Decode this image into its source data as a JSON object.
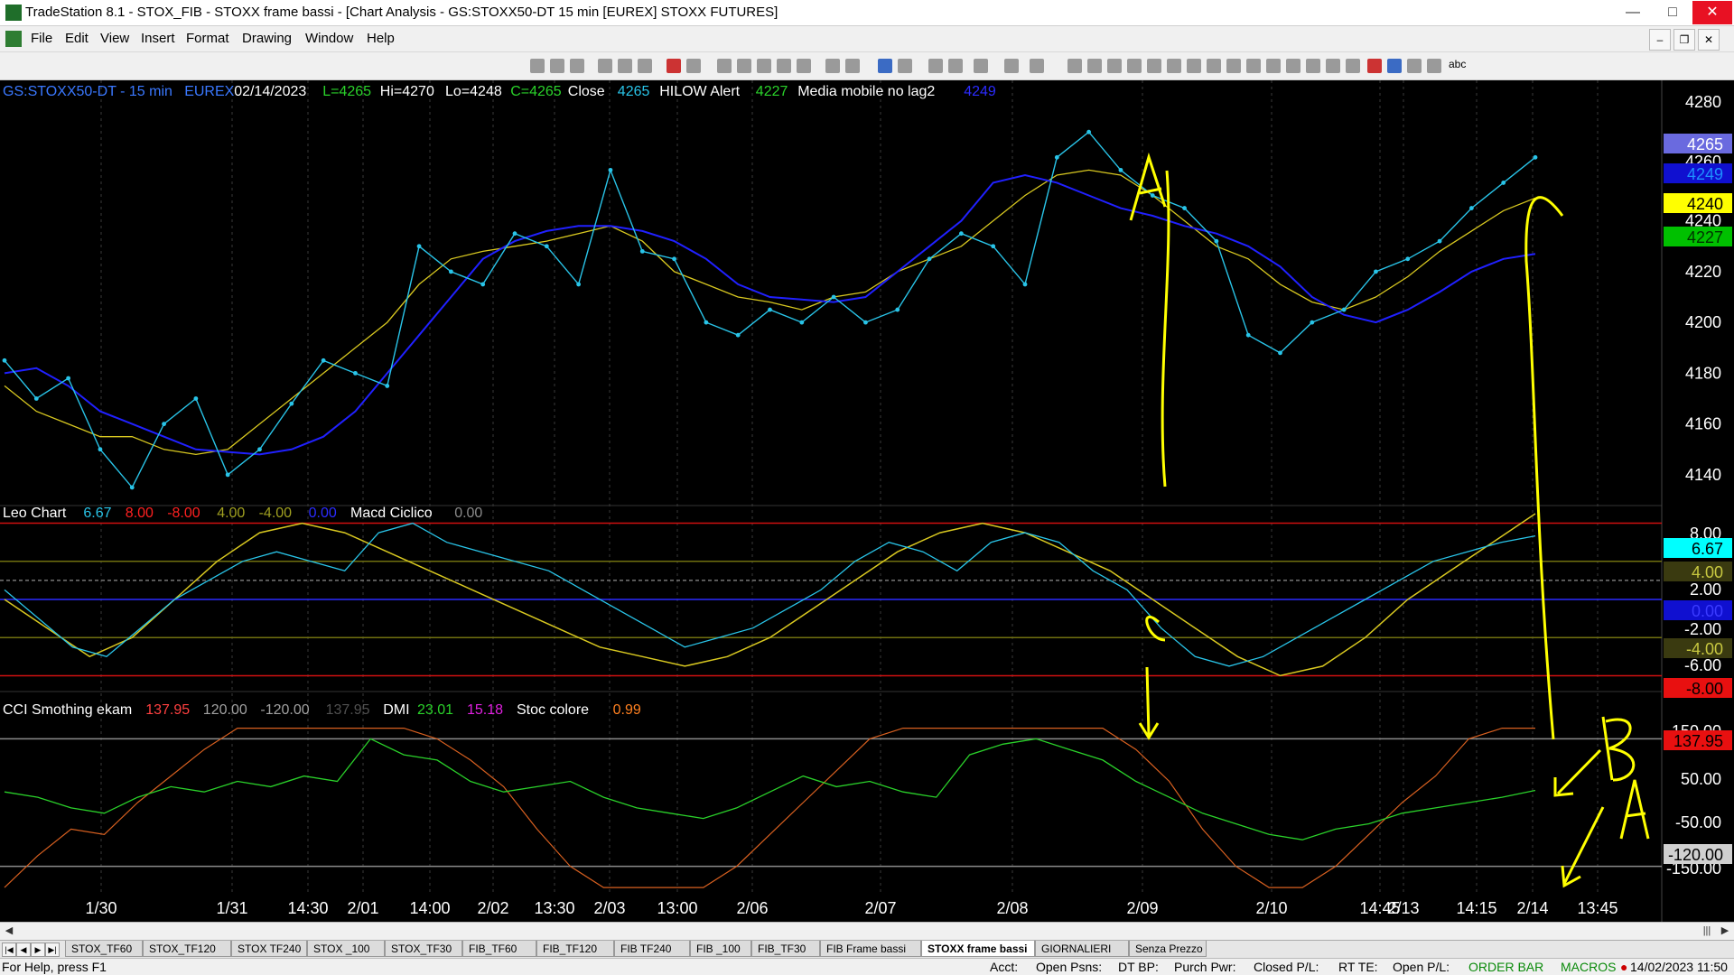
{
  "window": {
    "title": "TradeStation 8.1 - STOX_FIB - STOXX frame bassi - [Chart Analysis - GS:STOXX50-DT  15 min  [EUREX] STOXX FUTURES]"
  },
  "menu": [
    "File",
    "Edit",
    "View",
    "Insert",
    "Format",
    "Drawing",
    "Window",
    "Help"
  ],
  "toolbar": {
    "text_label": "abc"
  },
  "price_panel": {
    "header": [
      {
        "text": "GS:STOXX50-DT - 15 min",
        "color": "#3a78ff"
      },
      {
        "text": "EUREX",
        "color": "#3a78ff"
      },
      {
        "text": "02/14/2023",
        "color": "#ffffff"
      },
      {
        "text": "L=4265",
        "color": "#2ad12a"
      },
      {
        "text": "Hi=4270",
        "color": "#ffffff"
      },
      {
        "text": "Lo=4248",
        "color": "#ffffff"
      },
      {
        "text": "C=4265",
        "color": "#2ad12a"
      },
      {
        "text": "Close",
        "color": "#ffffff"
      },
      {
        "text": "4265",
        "color": "#29c4e8"
      },
      {
        "text": "HILOW Alert",
        "color": "#ffffff"
      },
      {
        "text": "4227",
        "color": "#2ad12a"
      },
      {
        "text": "Media mobile no lag2",
        "color": "#ffffff"
      },
      {
        "text": "4249",
        "color": "#2b2bff"
      }
    ],
    "axis_ticks": [
      "4240",
      "4220",
      "4200",
      "4180",
      "4160",
      "4140"
    ],
    "axis_partial": [
      "4280",
      "4260"
    ],
    "price_tags": [
      {
        "text": "4265",
        "bg": "#6a6adf",
        "fg": "#ffffff"
      },
      {
        "text": "4249",
        "bg": "#1010d0",
        "fg": "#1e90ff"
      },
      {
        "text": "4240",
        "bg": "#ffff00",
        "fg": "#000000"
      },
      {
        "text": "4227",
        "bg": "#00c000",
        "fg": "#003300"
      }
    ]
  },
  "macd_panel": {
    "header": [
      {
        "text": "Leo Chart",
        "color": "#ffffff"
      },
      {
        "text": "6.67",
        "color": "#29c4e8"
      },
      {
        "text": "8.00",
        "color": "#ff2020"
      },
      {
        "text": "-8.00",
        "color": "#ff2020"
      },
      {
        "text": "4.00",
        "color": "#a0a020"
      },
      {
        "text": "-4.00",
        "color": "#a0a020"
      },
      {
        "text": "0.00",
        "color": "#2b2bff"
      },
      {
        "text": "Macd Ciclico",
        "color": "#ffffff"
      },
      {
        "text": "0.00",
        "color": "#8a8a8a"
      }
    ],
    "axis_ticks": [
      "2.00",
      "-2.00",
      "-6.00"
    ],
    "axis_partial": [
      "8.00"
    ],
    "tags": [
      {
        "text": "6.67",
        "bg": "#00ffff",
        "fg": "#000000"
      },
      {
        "text": "4.00",
        "bg": "#3a3a10",
        "fg": "#c8c840"
      },
      {
        "text": "0.00",
        "bg": "#1010d0",
        "fg": "#3a3aff"
      },
      {
        "text": "-4.00",
        "bg": "#3a3a10",
        "fg": "#c8c840"
      },
      {
        "text": "-8.00",
        "bg": "#e81010",
        "fg": "#000000"
      }
    ]
  },
  "cci_panel": {
    "header": [
      {
        "text": "CCI Smothing ekam",
        "color": "#ffffff"
      },
      {
        "text": "137.95",
        "color": "#ff4040"
      },
      {
        "text": "120.00",
        "color": "#a0a0a0"
      },
      {
        "text": "-120.00",
        "color": "#a0a0a0"
      },
      {
        "text": "137.95",
        "color": "#505050"
      },
      {
        "text": "DMI",
        "color": "#ffffff"
      },
      {
        "text": "23.01",
        "color": "#2ad12a"
      },
      {
        "text": "15.18",
        "color": "#e020e0"
      },
      {
        "text": "Stoc colore",
        "color": "#ffffff"
      },
      {
        "text": "0.99",
        "color": "#ff8020"
      }
    ],
    "axis_ticks": [
      "50.00",
      "-50.00"
    ],
    "axis_partial": [
      "150.00",
      "-150.00"
    ],
    "tags": [
      {
        "text": "137.95",
        "bg": "#e81010",
        "fg": "#000000"
      },
      {
        "text": "120.00",
        "bg": "#d0d0d0",
        "fg": "#000000"
      },
      {
        "text": "-120.00",
        "bg": "#d0d0d0",
        "fg": "#000000"
      }
    ]
  },
  "time_axis": [
    "1/30",
    "1/31",
    "14:30",
    "2/01",
    "14:00",
    "2/02",
    "13:30",
    "2/03",
    "13:00",
    "2/06",
    "2/07",
    "2/08",
    "2/09",
    "2/10",
    "14:45",
    "2/13",
    "14:15",
    "2/14",
    "13:45"
  ],
  "annotations": [
    "A",
    "C",
    "B",
    "A"
  ],
  "chart_data": [
    {
      "type": "line",
      "title": "",
      "series": [
        {
          "name": "Close",
          "values": [
            4185,
            4170,
            4178,
            4150,
            4135,
            4160,
            4170,
            4140,
            4150,
            4168,
            4185,
            4180,
            4175,
            4230,
            4220,
            4215,
            4235,
            4230,
            4215,
            4260,
            4228,
            4225,
            4200,
            4195,
            4205,
            4200,
            4210,
            4200,
            4205,
            4225,
            4235,
            4230,
            4215,
            4265,
            4275,
            4260,
            4250,
            4245,
            4232,
            4195,
            4188,
            4200,
            4205,
            4220,
            4225,
            4232,
            4245,
            4255,
            4265
          ]
        },
        {
          "name": "HILOW Alert",
          "values": [
            4180,
            4182,
            4175,
            4165,
            4160,
            4155,
            4150,
            4149,
            4148,
            4150,
            4155,
            4165,
            4180,
            4195,
            4210,
            4225,
            4232,
            4236,
            4238,
            4238,
            4236,
            4232,
            4225,
            4215,
            4210,
            4209,
            4208,
            4210,
            4220,
            4230,
            4240,
            4255,
            4258,
            4255,
            4250,
            4245,
            4242,
            4238,
            4235,
            4230,
            4222,
            4210,
            4203,
            4200,
            4205,
            4212,
            4220,
            4225,
            4227
          ]
        },
        {
          "name": "Media mobile no lag2",
          "values": [
            4175,
            4165,
            4160,
            4155,
            4155,
            4150,
            4148,
            4150,
            4160,
            4170,
            4180,
            4190,
            4200,
            4215,
            4225,
            4228,
            4230,
            4232,
            4235,
            4238,
            4232,
            4220,
            4215,
            4210,
            4208,
            4205,
            4210,
            4212,
            4220,
            4225,
            4230,
            4240,
            4250,
            4258,
            4260,
            4258,
            4250,
            4240,
            4230,
            4225,
            4215,
            4208,
            4205,
            4210,
            4218,
            4228,
            4236,
            4244,
            4249
          ]
        }
      ],
      "ylim": [
        4130,
        4290
      ]
    },
    {
      "type": "line",
      "title": "",
      "series": [
        {
          "name": "Leo Chart",
          "values": [
            1,
            -2,
            -5,
            -6,
            -3,
            0,
            2,
            4,
            5,
            4,
            3,
            7,
            8,
            6,
            5,
            4,
            3,
            1,
            -1,
            -3,
            -5,
            -4,
            -3,
            -1,
            1,
            4,
            6,
            5,
            3,
            6,
            7,
            6,
            3,
            1,
            -3,
            -6,
            -7,
            -6,
            -4,
            -2,
            0,
            2,
            4,
            5,
            6,
            6.67
          ]
        },
        {
          "name": "Macd Ciclico",
          "values": [
            0,
            -3,
            -6,
            -4,
            0,
            4,
            7,
            8,
            7,
            5,
            3,
            1,
            -1,
            -3,
            -5,
            -6,
            -7,
            -6,
            -4,
            -1,
            2,
            5,
            7,
            8,
            7,
            5,
            3,
            0,
            -3,
            -6,
            -8,
            -7,
            -4,
            0,
            3,
            6,
            9
          ]
        }
      ],
      "ylim": [
        -9,
        9
      ]
    },
    {
      "type": "line",
      "title": "",
      "series": [
        {
          "name": "DMI",
          "values": [
            20,
            10,
            -10,
            -20,
            10,
            30,
            20,
            40,
            30,
            50,
            40,
            120,
            90,
            80,
            40,
            20,
            30,
            40,
            10,
            -10,
            -20,
            -30,
            -10,
            20,
            50,
            30,
            40,
            20,
            10,
            90,
            110,
            120,
            100,
            80,
            40,
            10,
            -20,
            -40,
            -60,
            -70,
            -50,
            -40,
            -20,
            -10,
            0,
            10,
            23.01
          ]
        },
        {
          "name": "Stoc colore",
          "values": [
            -160,
            -100,
            -50,
            -60,
            0,
            50,
            100,
            140,
            140,
            140,
            140,
            140,
            140,
            120,
            80,
            30,
            -50,
            -120,
            -160,
            -160,
            -160,
            -160,
            -120,
            -60,
            0,
            60,
            120,
            140,
            140,
            140,
            140,
            140,
            140,
            140,
            100,
            40,
            -50,
            -120,
            -160,
            -160,
            -120,
            -60,
            0,
            50,
            120,
            140,
            140
          ]
        }
      ],
      "ylim": [
        -170,
        170
      ]
    }
  ]
}
